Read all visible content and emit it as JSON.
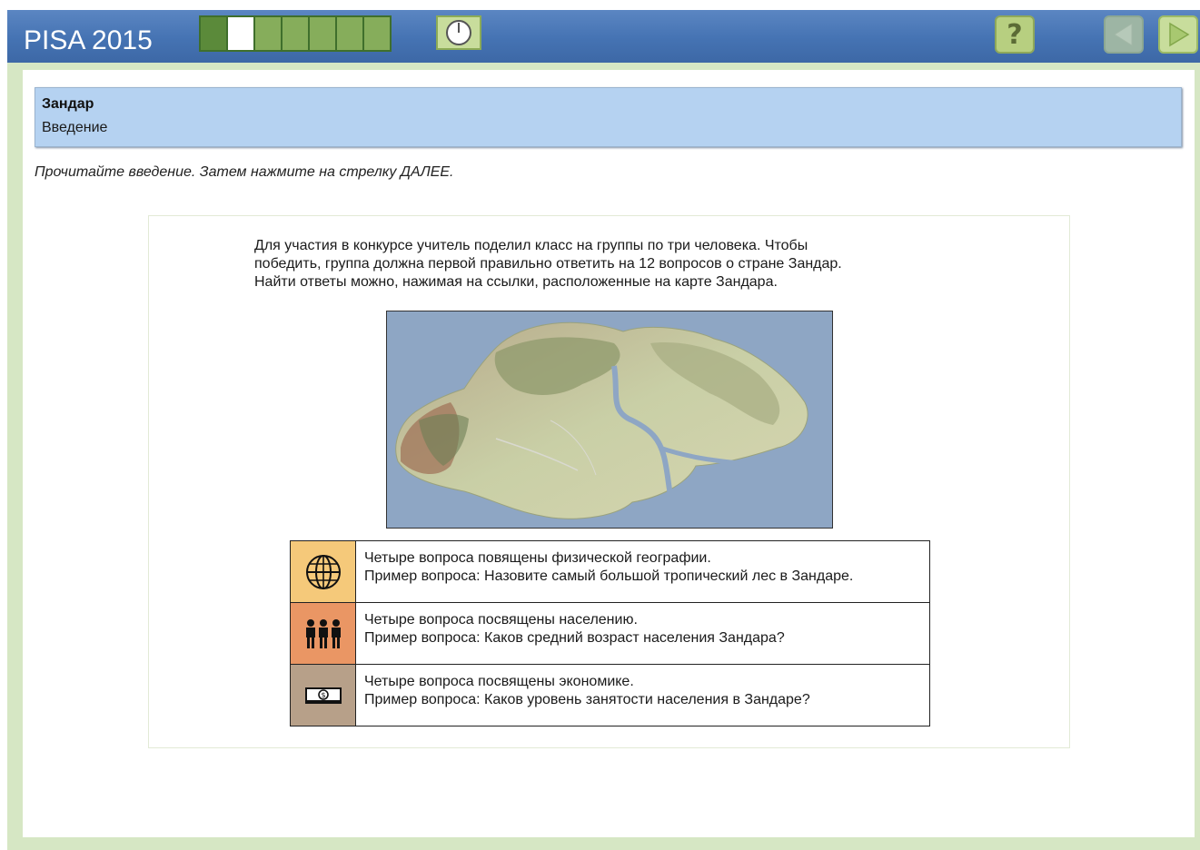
{
  "app": {
    "title": "PISA 2015"
  },
  "progress": {
    "total_segments": 7,
    "completed_segments": 1,
    "current_segment": 2
  },
  "toolbar": {
    "timer_icon": "clock-icon",
    "help_label": "?",
    "prev_icon": "arrow-left-icon",
    "next_icon": "arrow-right-icon"
  },
  "unit": {
    "name": "Зандар",
    "section": "Введение"
  },
  "instruction": "Прочитайте введение. Затем нажмите на стрелку ДАЛЕЕ.",
  "intro": {
    "lines": [
      "Для участия в конкурсе учитель поделил класс на группы по три человека. Чтобы",
      "победить, группа должна первой правильно ответить на 12 вопросов о стране Зандар.",
      "Найти ответы можно, нажимая на ссылки, расположенные на карте Зандара."
    ]
  },
  "topics": [
    {
      "icon": "globe-icon",
      "color": "#f5c97a",
      "line1": "Четыре вопроса повящены физической географии.",
      "line2": "Пример вопроса: Назовите самый большой тропический лес в Зандаре."
    },
    {
      "icon": "people-icon",
      "color": "#ea9664",
      "line1": "Четыре вопроса посвящены населению.",
      "line2": "Пример вопроса: Каков средний возраст населения Зандара?"
    },
    {
      "icon": "money-icon",
      "color": "#b7a089",
      "line1": "Четыре вопроса посвящены экономике.",
      "line2": "Пример вопроса: Каков уровень занятости населения в Зандаре?"
    }
  ],
  "colors": {
    "header": "#4573b3",
    "frame": "#d6e7c4",
    "title_panel": "#b5d2f1",
    "progress_green": "#86ad5b"
  }
}
